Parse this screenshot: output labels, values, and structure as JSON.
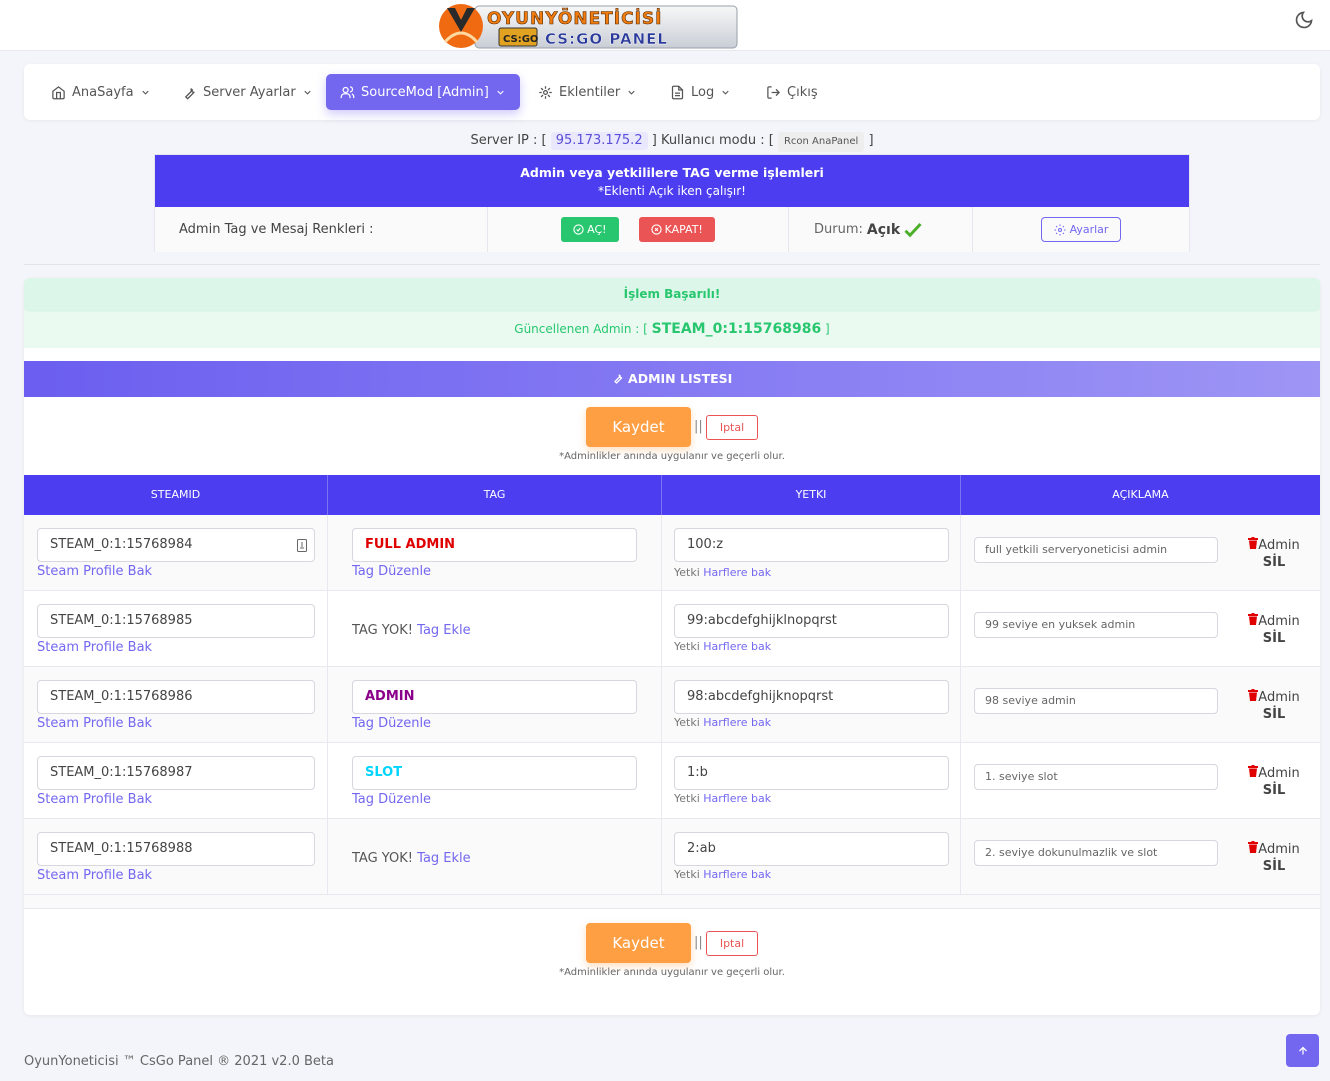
{
  "brand": {
    "logo_top": "OYUNYÖNETİCİSİ",
    "logo_badge": "CS:GO",
    "logo_bottom": "CS:GO PANEL"
  },
  "nav": {
    "items": [
      {
        "label": "AnaSayfa",
        "icon": "home-icon"
      },
      {
        "label": "Server Ayarlar",
        "icon": "wrench-icon"
      },
      {
        "label": "SourceMod [Admin]",
        "icon": "users-icon"
      },
      {
        "label": "Eklentiler",
        "icon": "plugin-icon"
      },
      {
        "label": "Log",
        "icon": "file-icon"
      },
      {
        "label": "Çıkış",
        "icon": "logout-icon"
      }
    ]
  },
  "server": {
    "ip_label": "Server IP : [",
    "ip": "95.173.175.2",
    "mode_label": "] Kullanıcı modu : [",
    "mode": "Rcon AnaPanel",
    "close": "]"
  },
  "tagbox": {
    "title": "Admin veya yetkililere TAG verme işlemleri",
    "subtitle": "*Eklenti Açık iken çalışır!",
    "row_label": "Admin Tag ve Mesaj Renkleri :",
    "on_label": "AÇ!",
    "off_label": "KAPAT!",
    "status_label": "Durum:",
    "status_value": "Açık",
    "settings_label": "Ayarlar"
  },
  "alerts": {
    "success": "İşlem Başarılı!",
    "updated_label": "Güncellenen Admin : [",
    "updated_value": "STEAM_0:1:15768986",
    "updated_close": "]"
  },
  "list": {
    "title": "ADMIN LISTESI",
    "save_label": "Kaydet",
    "separator": "||",
    "cancel_label": "Iptal",
    "note": "*Adminlikler anında uygulanır ve geçerli olur.",
    "columns": [
      "STEAMID",
      "TAG",
      "YETKI",
      "AÇIKLAMA"
    ],
    "profile_link": "Steam Profile Bak",
    "tag_edit_link": "Tag Düzenle",
    "tag_none": "TAG YOK!",
    "tag_add_link": "Tag Ekle",
    "yetki_label": "Yetki",
    "yetki_link": "Harflere bak",
    "delete_top": "Admin",
    "delete_bottom": "SİL",
    "rows": [
      {
        "steamid": "STEAM_0:1:15768984",
        "tag": "FULL ADMIN",
        "tag_color": "#e00000",
        "yetki": "100:z",
        "aciklama": "full yetkili serveryoneticisi admin"
      },
      {
        "steamid": "STEAM_0:1:15768985",
        "tag": "",
        "tag_color": "",
        "yetki": "99:abcdefghijklnopqrst",
        "aciklama": "99 seviye en yuksek admin"
      },
      {
        "steamid": "STEAM_0:1:15768986",
        "tag": "ADMIN",
        "tag_color": "#8b008b",
        "yetki": "98:abcdefghijknopqrst",
        "aciklama": "98 seviye admin"
      },
      {
        "steamid": "STEAM_0:1:15768987",
        "tag": "SLOT",
        "tag_color": "#00d5ff",
        "yetki": "1:b",
        "aciklama": "1. seviye slot"
      },
      {
        "steamid": "STEAM_0:1:15768988",
        "tag": "",
        "tag_color": "",
        "yetki": "2:ab",
        "aciklama": "2. seviye dokunulmazlik ve slot"
      }
    ]
  },
  "footer": {
    "text": "OyunYoneticisi ™ CsGo Panel ® 2021 v2.0 Beta"
  },
  "colors": {
    "primary": "#7367f0",
    "header": "#4c3ef0",
    "success": "#28c76f",
    "danger": "#ea5455",
    "warning": "#ff9f43"
  }
}
